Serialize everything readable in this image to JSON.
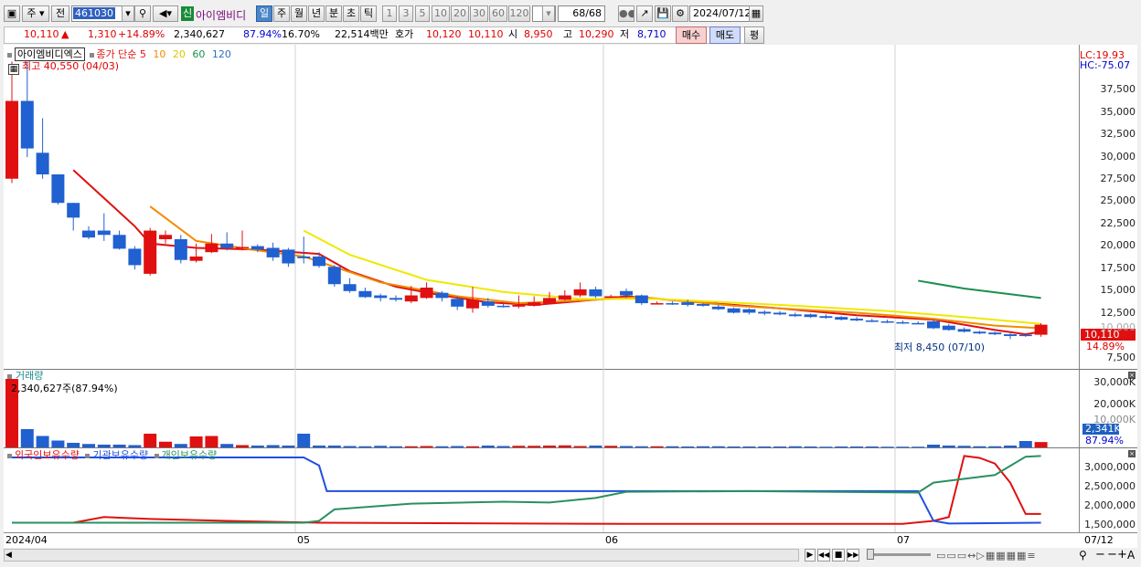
{
  "toolbar": {
    "mode": "주",
    "chart": "전",
    "code": "461030",
    "sin": "신",
    "name": "아이엠비디",
    "periods": [
      "일",
      "주",
      "월",
      "년",
      "분",
      "초",
      "틱"
    ],
    "numbers": [
      "1",
      "3",
      "5",
      "10",
      "20",
      "30",
      "60",
      "120"
    ],
    "count": "68",
    "count_total": "/68",
    "date": "2024/07/12"
  },
  "quote": {
    "price": "10,110",
    "change_arrow": "▲",
    "change": "1,310",
    "change_pct": "+14.89%",
    "volume": "2,340,627",
    "vol_pct": "87.94%",
    "turnover": "16.70%",
    "amount": "22,514백만",
    "hoga_label": "호가",
    "hoga_bid": "10,120",
    "hoga_ask": "10,110",
    "open_label": "시",
    "open": "8,950",
    "high_label": "고",
    "high": "10,290",
    "low_label": "저",
    "low": "8,710",
    "buy": "매수",
    "sell": "매도",
    "eval": "평"
  },
  "price_pane": {
    "name": "아이엠비디엑스",
    "legend_prefix": "종가 단순",
    "ma": [
      {
        "label": "5",
        "color": "#e01010"
      },
      {
        "label": "10",
        "color": "#f08c00"
      },
      {
        "label": "20",
        "color": "#f0e000"
      },
      {
        "label": "60",
        "color": "#1a9050"
      },
      {
        "label": "120",
        "color": "#3070c0"
      }
    ],
    "high_note": "최고 40,550 (04/03)",
    "low_note": "최저 8,450 (07/10)",
    "lc": "LC:19.93",
    "hc": "HC:-75.07",
    "last_price": "10,110",
    "last_pct": "14.89%",
    "yticks": [
      "37,500",
      "35,000",
      "32,500",
      "30,000",
      "27,500",
      "25,000",
      "22,500",
      "20,000",
      "17,500",
      "15,000",
      "12,500",
      "10,000",
      "7,500"
    ]
  },
  "volume_pane": {
    "title": "거래량",
    "info": "2,340,627주(87.94%)",
    "yticks": [
      "30,000K",
      "20,000K",
      "10,000K"
    ],
    "last": "2,341K",
    "last_pct": "87.94%"
  },
  "holding_pane": {
    "legend": [
      {
        "label": "외국인보유수량",
        "color": "#e01010"
      },
      {
        "label": "기관보유수량",
        "color": "#2050e0"
      },
      {
        "label": "개인보유수량",
        "color": "#2a9060"
      }
    ],
    "yticks": [
      "3,000,000",
      "2,500,000",
      "2,000,000",
      "1,500,000"
    ]
  },
  "xaxis": {
    "labels": [
      "2024/04",
      "05",
      "06",
      "07",
      "07/12"
    ]
  },
  "chart_data": [
    {
      "type": "candlestick",
      "title": "아이엠비디엑스",
      "y_range": [
        5000,
        42500
      ],
      "candles": [
        [
          27000,
          36000,
          26500,
          40550
        ],
        [
          36000,
          30500,
          29500,
          40550
        ],
        [
          30000,
          27500,
          27000,
          34000
        ],
        [
          27500,
          24200,
          24000,
          27500
        ],
        [
          24200,
          22500,
          21000,
          24200
        ],
        [
          21000,
          20200,
          20000,
          21500
        ],
        [
          21000,
          20500,
          19800,
          23000
        ],
        [
          20500,
          18900,
          18800,
          21000
        ],
        [
          18900,
          17000,
          16500,
          19200
        ],
        [
          16000,
          21000,
          15800,
          21300
        ],
        [
          20000,
          20500,
          19500,
          21000
        ],
        [
          20000,
          17600,
          17200,
          20500
        ],
        [
          17500,
          18000,
          17300,
          19500
        ],
        [
          18500,
          19500,
          18400,
          20600
        ],
        [
          19500,
          19000,
          18700,
          20800
        ],
        [
          19000,
          19100,
          18700,
          21000
        ],
        [
          19200,
          18800,
          18500,
          19400
        ],
        [
          19000,
          17900,
          17500,
          19600
        ],
        [
          18800,
          17200,
          16800,
          19000
        ],
        [
          18000,
          17800,
          17200,
          20300
        ],
        [
          18000,
          16900,
          16700,
          18500
        ],
        [
          16800,
          14800,
          14500,
          17000
        ],
        [
          14800,
          14000,
          13800,
          15500
        ],
        [
          14000,
          13300,
          13200,
          14400
        ],
        [
          13500,
          13200,
          12800,
          13700
        ],
        [
          13200,
          13000,
          12800,
          13500
        ],
        [
          12800,
          13500,
          12600,
          14600
        ],
        [
          13200,
          14400,
          13100,
          15000
        ],
        [
          13800,
          13200,
          12800,
          14000
        ],
        [
          13100,
          12200,
          11800,
          13400
        ],
        [
          12000,
          13000,
          11500,
          14500
        ],
        [
          12800,
          12300,
          12100,
          13200
        ],
        [
          12300,
          12200,
          12100,
          12600
        ],
        [
          12200,
          12400,
          12000,
          13500
        ],
        [
          12300,
          12700,
          12200,
          13400
        ],
        [
          12600,
          13200,
          12500,
          13900
        ],
        [
          13000,
          13500,
          12900,
          14100
        ],
        [
          13500,
          14200,
          13300,
          15000
        ],
        [
          14200,
          13400,
          13200,
          14500
        ],
        [
          13400,
          13400,
          13300,
          13600
        ],
        [
          14000,
          13500,
          13200,
          14300
        ],
        [
          13500,
          12600,
          12400,
          13600
        ],
        [
          12600,
          12600,
          12500,
          12800
        ],
        [
          12600,
          12500,
          12400,
          12800
        ],
        [
          12700,
          12400,
          12200,
          13000
        ],
        [
          12500,
          12300,
          12200,
          12600
        ],
        [
          12200,
          11900,
          11800,
          12400
        ],
        [
          12000,
          11500,
          11400,
          12100
        ],
        [
          11900,
          11500,
          11300,
          12000
        ],
        [
          11600,
          11400,
          11200,
          11800
        ],
        [
          11500,
          11300,
          11200,
          11700
        ],
        [
          11300,
          11100,
          11000,
          11500
        ],
        [
          11300,
          11000,
          10900,
          11400
        ],
        [
          11100,
          10900,
          10800,
          11300
        ],
        [
          11000,
          10700,
          10600,
          11100
        ],
        [
          10800,
          10600,
          10500,
          11000
        ],
        [
          10600,
          10500,
          10400,
          10800
        ],
        [
          10500,
          10400,
          10300,
          10700
        ],
        [
          10400,
          10300,
          10200,
          10600
        ],
        [
          10300,
          10250,
          10200,
          10500
        ],
        [
          10500,
          9700,
          9600,
          10600
        ],
        [
          10000,
          9500,
          9400,
          10200
        ],
        [
          9600,
          9300,
          9200,
          9800
        ],
        [
          9300,
          9100,
          9000,
          9400
        ],
        [
          9200,
          9000,
          8900,
          9300
        ],
        [
          9000,
          8800,
          8450,
          9100
        ],
        [
          8950,
          8800,
          8700,
          9000
        ],
        [
          8950,
          10110,
          8710,
          10290
        ]
      ],
      "ma": {
        "5": [
          [
            4,
            28000
          ],
          [
            8,
            21500
          ],
          [
            9,
            19500
          ],
          [
            12,
            19000
          ],
          [
            16,
            18800
          ],
          [
            20,
            18300
          ],
          [
            22,
            16300
          ],
          [
            25,
            14500
          ],
          [
            28,
            13500
          ],
          [
            31,
            12700
          ],
          [
            34,
            12400
          ],
          [
            38,
            13000
          ],
          [
            40,
            13400
          ],
          [
            44,
            12800
          ],
          [
            50,
            12000
          ],
          [
            55,
            11200
          ],
          [
            60,
            10700
          ],
          [
            64,
            9500
          ],
          [
            66,
            9000
          ],
          [
            67,
            9300
          ]
        ],
        "10": [
          [
            9,
            23800
          ],
          [
            12,
            19800
          ],
          [
            16,
            18700
          ],
          [
            19,
            18000
          ],
          [
            24,
            15000
          ],
          [
            29,
            13400
          ],
          [
            33,
            12600
          ],
          [
            38,
            13000
          ],
          [
            41,
            13300
          ],
          [
            47,
            12300
          ],
          [
            55,
            11500
          ],
          [
            60,
            10800
          ],
          [
            64,
            10000
          ],
          [
            67,
            9700
          ]
        ],
        "20": [
          [
            19,
            21000
          ],
          [
            22,
            18200
          ],
          [
            27,
            15300
          ],
          [
            32,
            13900
          ],
          [
            37,
            13100
          ],
          [
            42,
            13100
          ],
          [
            50,
            12400
          ],
          [
            57,
            11700
          ],
          [
            62,
            11000
          ],
          [
            67,
            10200
          ]
        ],
        "60": [
          [
            59,
            15200
          ],
          [
            62,
            14300
          ],
          [
            67,
            13200
          ]
        ]
      }
    },
    {
      "type": "bar",
      "title": "거래량",
      "unit": "K",
      "values": [
        30000,
        8000,
        5000,
        3000,
        2000,
        1500,
        1200,
        1200,
        1000,
        6000,
        2500,
        1500,
        4800,
        5000,
        1500,
        1000,
        800,
        1000,
        800,
        6000,
        800,
        800,
        600,
        500,
        700,
        500,
        500,
        600,
        500,
        600,
        500,
        800,
        600,
        700,
        700,
        800,
        900,
        600,
        800,
        700,
        600,
        500,
        500,
        500,
        400,
        500,
        500,
        400,
        400,
        400,
        400,
        500,
        400,
        300,
        400,
        400,
        400,
        300,
        300,
        300,
        1200,
        800,
        700,
        500,
        500,
        800,
        2800,
        2341
      ]
    },
    {
      "type": "line",
      "title": "보유수량",
      "ylim": [
        1200000,
        3400000
      ],
      "series": [
        {
          "name": "외국인보유수량",
          "points": [
            [
              0,
              1450000
            ],
            [
              4,
              1450000
            ],
            [
              6,
              1600000
            ],
            [
              9,
              1550000
            ],
            [
              14,
              1500000
            ],
            [
              20,
              1450000
            ],
            [
              40,
              1420000
            ],
            [
              58,
              1420000
            ],
            [
              60,
              1500000
            ],
            [
              61,
              1600000
            ],
            [
              62,
              3200000
            ],
            [
              63,
              3150000
            ],
            [
              64,
              3000000
            ],
            [
              65,
              2500000
            ],
            [
              66,
              1680000
            ],
            [
              67,
              1680000
            ]
          ]
        },
        {
          "name": "기관보유수량",
          "points": [
            [
              0,
              3160000
            ],
            [
              19,
              3160000
            ],
            [
              20,
              2950000
            ],
            [
              20.5,
              2280000
            ],
            [
              35,
              2280000
            ],
            [
              45,
              2280000
            ],
            [
              59,
              2280000
            ],
            [
              60,
              1500000
            ],
            [
              61,
              1430000
            ],
            [
              67,
              1450000
            ]
          ]
        },
        {
          "name": "개인보유수량",
          "points": [
            [
              0,
              1450000
            ],
            [
              19,
              1450000
            ],
            [
              20,
              1500000
            ],
            [
              21,
              1800000
            ],
            [
              26,
              1950000
            ],
            [
              32,
              2000000
            ],
            [
              35,
              1980000
            ],
            [
              38,
              2100000
            ],
            [
              40,
              2260000
            ],
            [
              48,
              2280000
            ],
            [
              59,
              2240000
            ],
            [
              60,
              2500000
            ],
            [
              61,
              2550000
            ],
            [
              64,
              2700000
            ],
            [
              66,
              3180000
            ],
            [
              67,
              3200000
            ]
          ]
        }
      ]
    }
  ]
}
